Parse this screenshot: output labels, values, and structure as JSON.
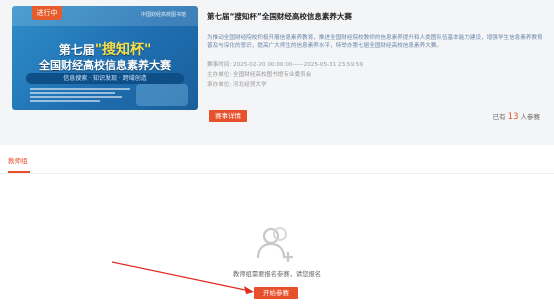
{
  "banner": {
    "status_tag": "进行中",
    "logo_text": "中国财经高校图书馆",
    "line1_prefix": "第七届",
    "line1_highlight": "\"搜知杯\"",
    "line2": "全国财经高校信息素养大赛",
    "slogan": "信息搜索 · 知识发现 · 跨域创造"
  },
  "competition": {
    "title": "第七届“搜知杯”全国财经高校信息素养大赛",
    "description": "为推动全国财经院校积极开展信息素养教育，推进全国财经院校教师的信息素养提升和人类图队伍基本能力建设，增强学生信息素养教育普及与深化的意识，提高广大师生的信息素养水平，特举办第七届全国财经高校信息素养大赛。",
    "time_label": "赛事时间:",
    "time_value": "2025-02-20 00:00:00——2025-05-31 23:59:59",
    "host_label": "主办单位:",
    "host_value": "全国财经高校图书馆专业委员会",
    "organizer_label": "承办单位:",
    "organizer_value": "河北经贸大学",
    "detail_button": "赛事详情",
    "count_prefix": "已有",
    "count_value": "13",
    "count_suffix": "人参赛"
  },
  "tabs": {
    "active": "教师组"
  },
  "empty_state": {
    "message": "教师组需要报名参赛，请您报名",
    "start_button": "开始参赛"
  },
  "colors": {
    "accent": "#e6502a",
    "banner_blue": "#1f6fb2",
    "desc_text": "#6a84a8"
  }
}
